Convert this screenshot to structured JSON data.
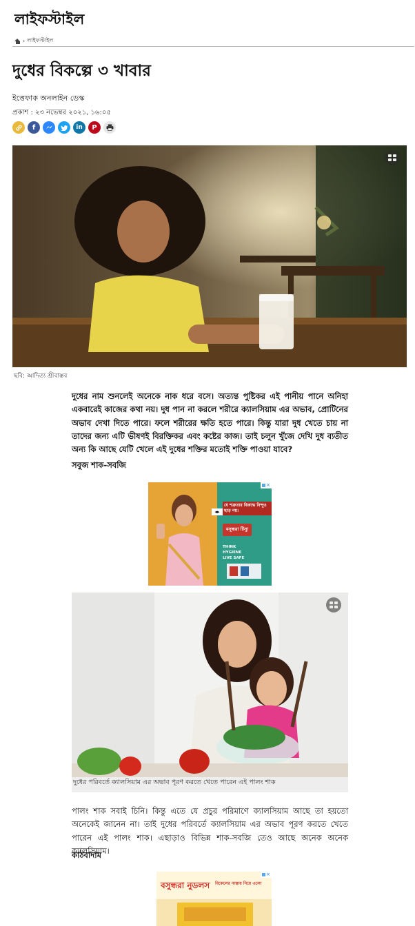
{
  "section": {
    "name": "লাইফস্টাইল"
  },
  "breadcrumb": {
    "home_icon": "home-icon",
    "separator": "›",
    "current": "লাইফস্টাইল"
  },
  "article": {
    "title": "দুধের বিকল্পে ৩ খাবার",
    "author": "ইত্তেফাক অনলাইন ডেস্ক",
    "published": "প্রকাশ : ২৩ নভেম্বর ২০২১, ১৬:০৫",
    "share_icons": [
      "link-icon",
      "facebook-icon",
      "messenger-icon",
      "twitter-icon",
      "linkedin-icon",
      "pinterest-icon",
      "print-icon"
    ],
    "hero_caption": "ছবি: আদিত্য শ্রীবাস্তব",
    "intro": "দুধের নাম শুনলেই অনেকে নাক ধরে বসে। অত্যন্ত পুষ্টিকর এই পানীয় পানে অনিহা একবারেই কাজের কথা নয়। দুধ পান না করলে শরীরে ক্যালসিয়াম এর অভাব, প্রোটিনের অভাব দেখা দিতে পারে। ফলে শরীরের ক্ষতি হতে পারে। কিন্তু যারা দুধ খেতে চায় না তাদের জন্য এটি ভীষণই বিরক্তিকর এবং কষ্টের কাজ। তাই চলুন খুঁজে দেখি দুধ ব্যতীত অন্য কি আছে যেটি খেলে এই দুধের শক্তির মতোই শক্তি পাওয়া যাবে?",
    "subhead1": "সবুজ শাক-সবজি",
    "figure_caption": "দুধের পরিবর্তে ক্যালসিয়াম এর অভাব পূরণ করতে খেতে পারেন এই পালং শাক",
    "para2": "পালং শাক সবাই চিনি। কিন্তু এতে যে প্রচুর পরিমাণে ক্যালসিয়াম আছে তা হয়তো অনেকেই জানেন না। তাই দুধের পরিবর্তে ক্যালসিয়াম এর অভাব পূরণ করতে খেতে পারেন এই পালং শাক। এছাড়াও বিভিন্ন শাক-সবজি তেও আছে অনেক অনেক ক্যালসিয়াম।",
    "subhead2": "কাঠবাদাম"
  },
  "ads": {
    "ad1": {
      "headline": "যে শত্রুতার বিরুদ্ধে বিন্দুও ছাড় নয়।",
      "brand": "বসুন্ধরা টিস্যু",
      "slogan": "THINK HYGIENE LIVE SAFE"
    },
    "ad2": {
      "brand": "বসুন্ধরা নুডলস",
      "headline": "বিকেলের নাস্তায় নিয়ে এলো"
    }
  }
}
